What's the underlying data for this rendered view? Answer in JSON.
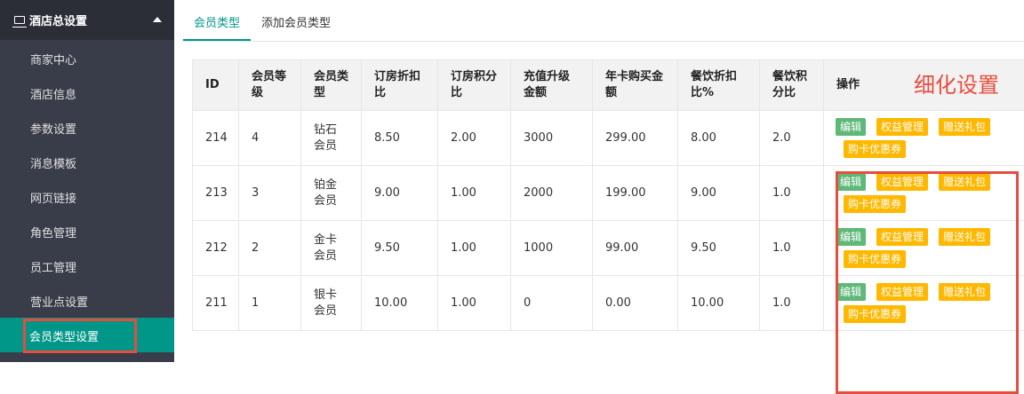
{
  "sidebar": {
    "header": "酒店总设置",
    "items": [
      {
        "label": "商家中心"
      },
      {
        "label": "酒店信息"
      },
      {
        "label": "参数设置"
      },
      {
        "label": "消息模板"
      },
      {
        "label": "网页链接"
      },
      {
        "label": "角色管理"
      },
      {
        "label": "员工管理"
      },
      {
        "label": "营业点设置"
      },
      {
        "label": "会员类型设置"
      }
    ]
  },
  "tabs": [
    {
      "label": "会员类型"
    },
    {
      "label": "添加会员类型"
    }
  ],
  "table": {
    "headers": [
      "ID",
      "会员等级",
      "会员类型",
      "订房折扣比",
      "订房积分比",
      "充值升级金额",
      "年卡购买金额",
      "餐饮折扣比%",
      "餐饮积分比",
      "操作"
    ],
    "rows": [
      [
        "214",
        "4",
        "钻石会员",
        "8.50",
        "2.00",
        "3000",
        "299.00",
        "8.00",
        "2.0"
      ],
      [
        "213",
        "3",
        "铂金会员",
        "9.00",
        "1.00",
        "2000",
        "199.00",
        "9.00",
        "1.0"
      ],
      [
        "212",
        "2",
        "金卡会员",
        "9.50",
        "1.00",
        "1000",
        "99.00",
        "9.50",
        "1.0"
      ],
      [
        "211",
        "1",
        "银卡会员",
        "10.00",
        "1.00",
        "0",
        "0.00",
        "10.00",
        "1.0"
      ]
    ],
    "actions": {
      "edit": "编辑",
      "rights": "权益管理",
      "gift": "赠送礼包",
      "coupon": "购卡优惠券"
    }
  },
  "annotation": {
    "label": "细化设置"
  },
  "colors": {
    "sidebar_bg": "#393d49",
    "accent": "#009688",
    "highlight": "#e84c3d",
    "btn_green": "#5fb878",
    "btn_orange": "#ffb800"
  }
}
